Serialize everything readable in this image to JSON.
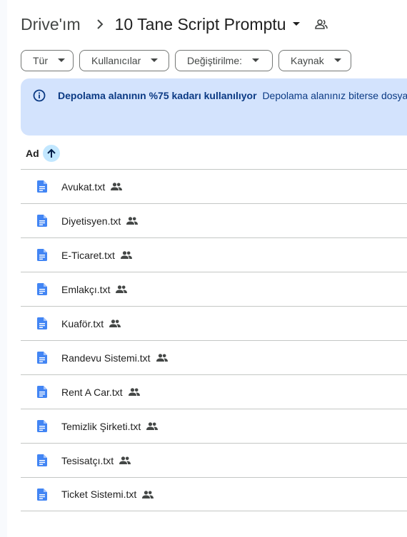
{
  "breadcrumb": {
    "root": "Drive'ım",
    "folder": "10 Tane Script Promptu"
  },
  "filters": {
    "type": "Tür",
    "people": "Kullanıcılar",
    "modified": "Değiştirilme:",
    "source": "Kaynak"
  },
  "banner": {
    "title": "Depolama alanının %75 kadarı kullanılıyor",
    "body": "Depolama alanınız biterse dosya o"
  },
  "list": {
    "sort_label": "Ad",
    "files": [
      {
        "name": "Avukat.txt"
      },
      {
        "name": "Diyetisyen.txt"
      },
      {
        "name": "E-Ticaret.txt"
      },
      {
        "name": "Emlakçı.txt"
      },
      {
        "name": "Kuaför.txt"
      },
      {
        "name": "Randevu Sistemi.txt"
      },
      {
        "name": "Rent A Car.txt"
      },
      {
        "name": "Temizlik Şirketi.txt"
      },
      {
        "name": "Tesisatçı.txt"
      },
      {
        "name": "Ticket Sistemi.txt"
      }
    ]
  },
  "icons": {
    "file": "doc-icon",
    "shared": "people-icon",
    "info": "info-icon",
    "sort": "arrow-up-icon"
  },
  "colors": {
    "accent": "#1a73e8",
    "doc": "#4285f4",
    "banner_bg": "#d3e3fd",
    "banner_text": "#0b3a84",
    "sort_bg": "#c2e7ff"
  }
}
